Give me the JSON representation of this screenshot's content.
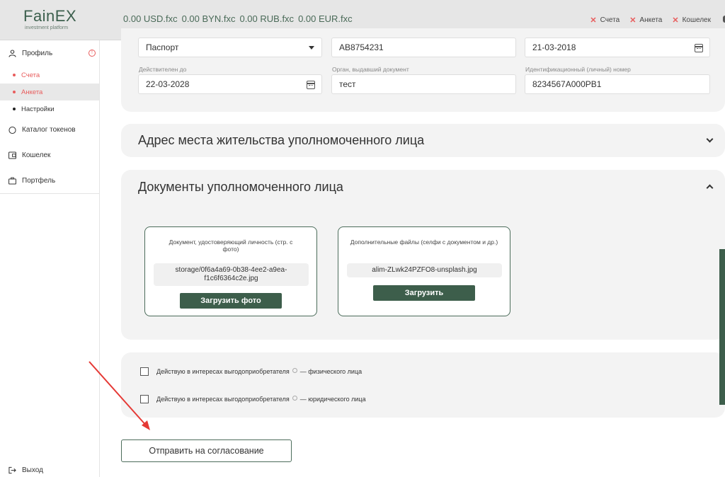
{
  "header": {
    "logo_name": "FainEX",
    "logo_sub": "investment platform",
    "balances": [
      "0.00 USD.fxc",
      "0.00 BYN.fxc",
      "0.00 RUB.fxc",
      "0.00 EUR.fxc"
    ],
    "status": [
      "Счета",
      "Анкета",
      "Кошелек"
    ],
    "status_color": "#e85c5c"
  },
  "sidebar": {
    "profile": "Профиль",
    "sub_items": [
      "Счета",
      "Анкета",
      "Настройки"
    ],
    "catalog": "Каталог токенов",
    "wallet": "Кошелек",
    "portfolio": "Портфель",
    "logout": "Выход"
  },
  "document": {
    "doc_type": "Паспорт",
    "doc_number": "AB8754231",
    "issue_date": "21-03-2018",
    "valid_until_label": "Действителен до",
    "valid_until": "22-03-2028",
    "issuer_label": "Орган, выдавший документ",
    "issuer": "тест",
    "id_number_label": "Идентификационный (личный) номер",
    "id_number": "8234567A000PB1"
  },
  "sections": {
    "address_title": "Адрес места жительства уполномоченного лица",
    "documents_title": "Документы уполномоченного лица"
  },
  "uploads": [
    {
      "label": "Документ, удостоверяющий личность (стр. с фото)",
      "file": "storage/0f6a4a69-0b38-4ee2-a9ea-f1c6f6364c2e.jpg",
      "button": "Загрузить фото"
    },
    {
      "label": "Дополнительные файлы (селфи с документом и др.)",
      "file": "alim-ZLwk24PZFO8-unsplash.jpg",
      "button": "Загрузить"
    }
  ],
  "beneficiary": {
    "row1_text": "Действую в интересах выгодоприобретателя",
    "row1_suffix": "— физического лица",
    "row2_text": "Действую в интересах выгодоприобретателя",
    "row2_suffix": "— юридического лица"
  },
  "submit_label": "Отправить на согласование",
  "accent_color": "#3d5e4b"
}
